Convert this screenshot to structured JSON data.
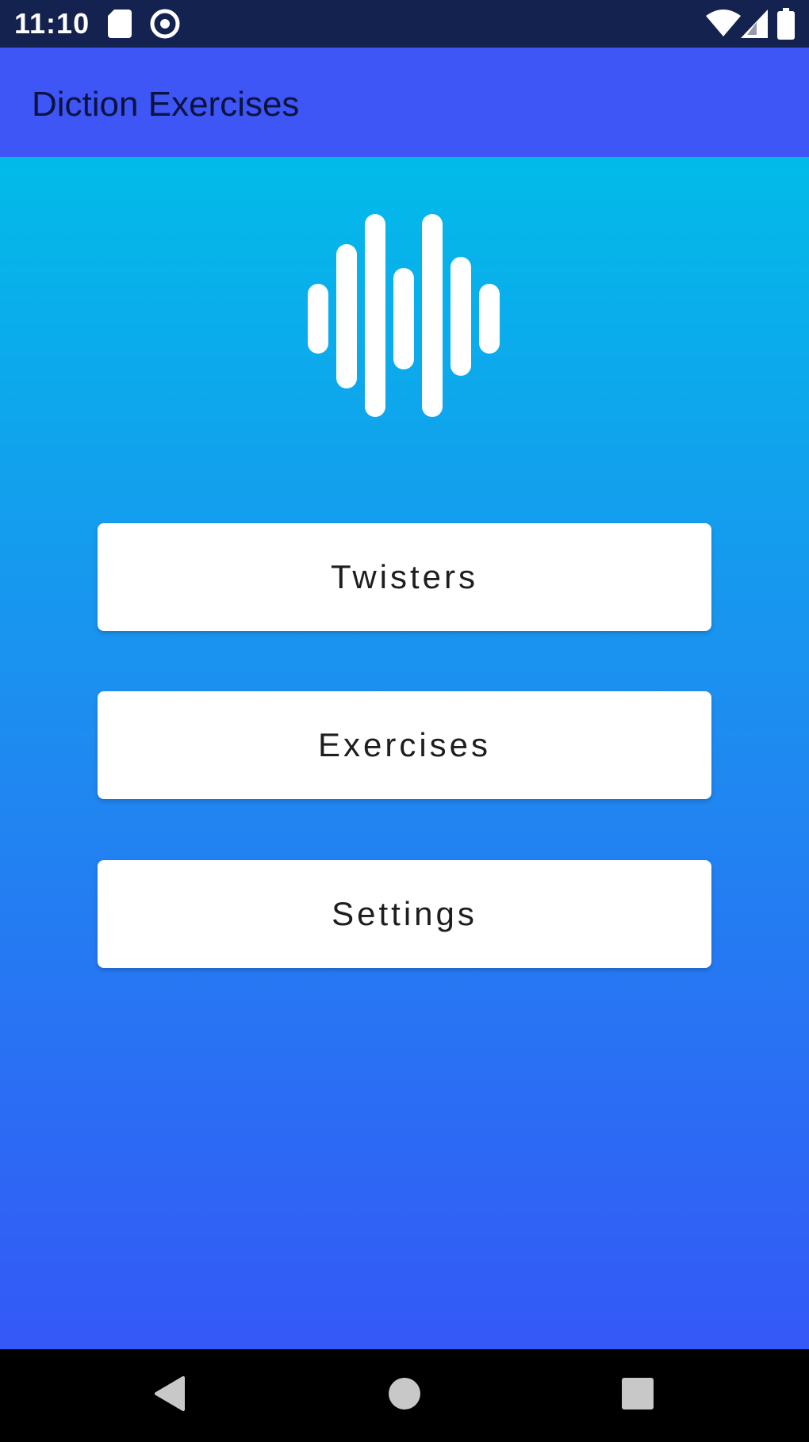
{
  "status_bar": {
    "time": "11:10",
    "icons": [
      "sd-card-icon",
      "vpn-icon",
      "wifi-icon",
      "signal-icon",
      "battery-icon"
    ]
  },
  "app_bar": {
    "title": "Diction Exercises"
  },
  "logo": {
    "icon": "sound-wave-icon",
    "color": "#ffffff"
  },
  "menu": {
    "buttons": [
      {
        "label": "Twisters"
      },
      {
        "label": "Exercises"
      },
      {
        "label": "Settings"
      }
    ]
  },
  "nav_bar": {
    "buttons": [
      "back-icon",
      "home-icon",
      "recents-icon"
    ]
  },
  "colors": {
    "status_bar": "#13224e",
    "app_bar": "#3d56f5",
    "gradient_top": "#02bbe9",
    "gradient_bottom": "#3458f6",
    "button_bg": "#ffffff",
    "nav_bar": "#000000"
  }
}
